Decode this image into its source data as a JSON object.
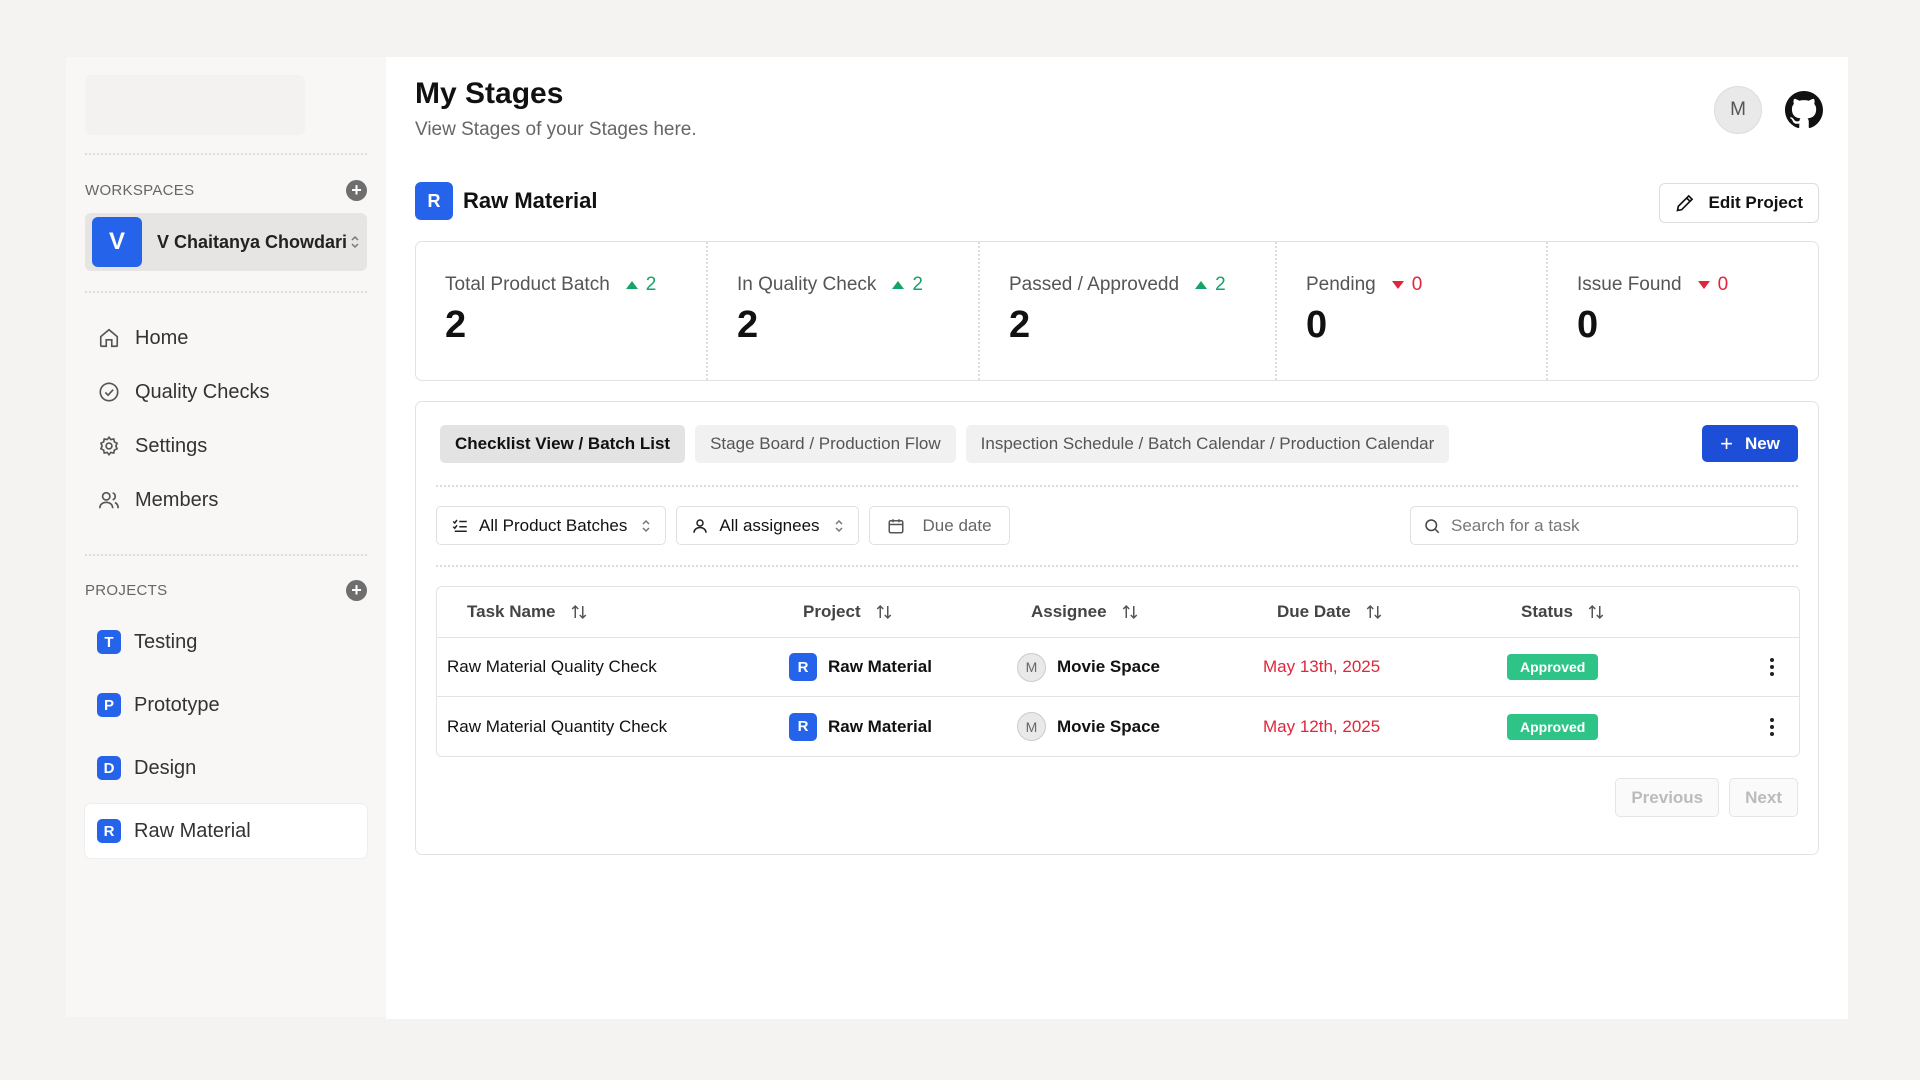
{
  "sidebar": {
    "workspaces_label": "WORKSPACES",
    "workspace": {
      "initial": "V",
      "name": "V Chaitanya Chowdari"
    },
    "nav": [
      {
        "label": "Home",
        "icon": "home-icon"
      },
      {
        "label": "Quality Checks",
        "icon": "check-circle-icon"
      },
      {
        "label": "Settings",
        "icon": "gear-icon"
      },
      {
        "label": "Members",
        "icon": "users-icon"
      }
    ],
    "projects_label": "PROJECTS",
    "projects": [
      {
        "initial": "T",
        "label": "Testing",
        "active": false
      },
      {
        "initial": "P",
        "label": "Prototype",
        "active": false
      },
      {
        "initial": "D",
        "label": "Design",
        "active": false
      },
      {
        "initial": "R",
        "label": "Raw Material",
        "active": true
      }
    ]
  },
  "header": {
    "title": "My Stages",
    "subtitle": "View Stages of your Stages here.",
    "avatar_initial": "M"
  },
  "project": {
    "initial": "R",
    "name": "Raw Material",
    "edit_label": "Edit Project"
  },
  "stats": [
    {
      "label": "Total Product Batch",
      "delta": "2",
      "direction": "up",
      "value": "2"
    },
    {
      "label": "In Quality Check",
      "delta": "2",
      "direction": "up",
      "value": "2"
    },
    {
      "label": "Passed / Approvedd",
      "delta": "2",
      "direction": "up",
      "value": "2"
    },
    {
      "label": "Pending",
      "delta": "0",
      "direction": "down",
      "value": "0"
    },
    {
      "label": "Issue Found",
      "delta": "0",
      "direction": "down",
      "value": "0"
    }
  ],
  "tabs": [
    {
      "label": "Checklist View / Batch List",
      "active": true
    },
    {
      "label": "Stage Board / Production Flow",
      "active": false
    },
    {
      "label": "Inspection Schedule / Batch Calendar / Production Calendar",
      "active": false
    }
  ],
  "new_label": "New",
  "filters": {
    "batches": "All Product Batches",
    "assignees": "All assignees",
    "due_date": "Due date",
    "search_placeholder": "Search for a task"
  },
  "table": {
    "columns": [
      "Task Name",
      "Project",
      "Assignee",
      "Due Date",
      "Status"
    ],
    "rows": [
      {
        "task": "Raw Material Quality Check",
        "project_initial": "R",
        "project": "Raw Material",
        "assignee_initial": "M",
        "assignee": "Movie Space",
        "due": "May 13th, 2025",
        "status": "Approved"
      },
      {
        "task": "Raw Material Quantity Check",
        "project_initial": "R",
        "project": "Raw Material",
        "assignee_initial": "M",
        "assignee": "Movie Space",
        "due": "May 12th, 2025",
        "status": "Approved"
      }
    ]
  },
  "pager": {
    "previous": "Previous",
    "next": "Next"
  },
  "colors": {
    "accent": "#2563eb",
    "primary_button": "#1d4ed8",
    "up": "#16a36a",
    "down": "#e0263c",
    "approved": "#2ec487"
  }
}
